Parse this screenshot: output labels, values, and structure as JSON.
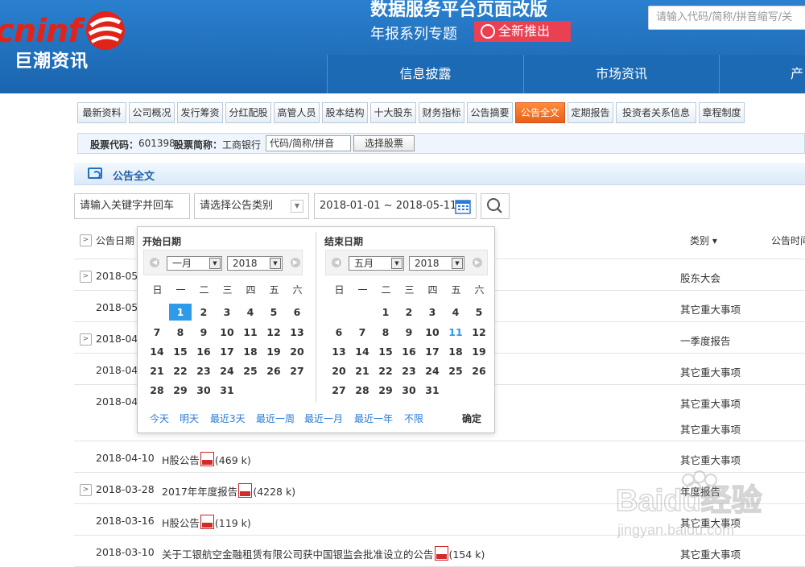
{
  "header": {
    "logo_text": "cninf",
    "logo_cn": "巨潮资讯",
    "promo_title": "数据服务平台页面改版",
    "promo_sub": "年报系列专题",
    "promo_badge": "全新推出",
    "search_placeholder": "请输入代码/简称/拼音缩写/关",
    "nav": [
      "信息披露",
      "市场资讯",
      "产品"
    ]
  },
  "tabs": [
    "最新资料",
    "公司概况",
    "发行筹资",
    "分红配股",
    "高管人员",
    "股本结构",
    "十大股东",
    "财务指标",
    "公告摘要",
    "公告全文",
    "定期报告",
    "投资者关系信息",
    "章程制度"
  ],
  "active_tab": "公告全文",
  "stock_bar": {
    "code_label": "股票代码：",
    "code": "601398",
    "name_label": "股票简称：",
    "name": "工商银行",
    "input_value": "代码/简称/拼音",
    "select_button": "选择股票"
  },
  "section_title": "公告全文",
  "filters": {
    "keyword_placeholder": "请输入关键字并回车",
    "category_placeholder": "请选择公告类别",
    "date_range": "2018-01-01 ~ 2018-05-11"
  },
  "table": {
    "col_date": "公告日期",
    "col_category": "类别",
    "col_time": "公告时间",
    "rows": [
      {
        "date": "2018-05",
        "title": "",
        "size": "",
        "category": "股东大会",
        "expand": true
      },
      {
        "date": "2018-05",
        "title": "",
        "size": "",
        "category": "其它重大事项",
        "expand": false
      },
      {
        "date": "2018-04",
        "title": "",
        "size": "",
        "category": "一季度报告",
        "expand": true
      },
      {
        "date": "2018-04",
        "title": "",
        "size": "",
        "category": "其它重大事项",
        "expand": false
      },
      {
        "date": "2018-04",
        "title": "",
        "size": "",
        "category": "其它重大事项",
        "category2": "其它重大事项",
        "expand": false
      },
      {
        "date": "2018-04-10",
        "title": "H股公告",
        "size": "(469 k)",
        "category": "其它重大事项",
        "expand": false
      },
      {
        "date": "2018-03-28",
        "title": "2017年年度报告",
        "size": "(4228 k)",
        "category": "年度报告",
        "expand": true
      },
      {
        "date": "2018-03-16",
        "title": "H股公告",
        "size": "(119 k)",
        "category": "其它重大事项",
        "expand": false
      },
      {
        "date": "2018-03-10",
        "title": "关于工银航空金融租赁有限公司获中国银监会批准设立的公告",
        "size": "(154 k)",
        "category": "其它重大事项",
        "expand": false
      }
    ]
  },
  "calendar": {
    "start_label": "开始日期",
    "end_label": "结束日期",
    "weekdays": [
      "日",
      "一",
      "二",
      "三",
      "四",
      "五",
      "六"
    ],
    "start": {
      "month": "一月",
      "year": "2018",
      "selected_day": 1,
      "weeks": [
        [
          "",
          "",
          "1",
          "2",
          "3",
          "4",
          "5",
          "6"
        ],
        [
          "7",
          "8",
          "9",
          "10",
          "11",
          "12",
          "13"
        ],
        [
          "14",
          "15",
          "16",
          "17",
          "18",
          "19",
          "20"
        ],
        [
          "21",
          "22",
          "23",
          "24",
          "25",
          "26",
          "27"
        ],
        [
          "28",
          "29",
          "30",
          "31",
          "",
          "",
          ""
        ]
      ]
    },
    "end": {
      "month": "五月",
      "year": "2018",
      "today_day": 11,
      "weeks": [
        [
          "",
          "",
          "1",
          "2",
          "3",
          "4",
          "5"
        ],
        [
          "6",
          "7",
          "8",
          "9",
          "10",
          "11",
          "12"
        ],
        [
          "13",
          "14",
          "15",
          "16",
          "17",
          "18",
          "19"
        ],
        [
          "20",
          "21",
          "22",
          "23",
          "24",
          "25",
          "26"
        ],
        [
          "27",
          "28",
          "29",
          "30",
          "31",
          "",
          ""
        ]
      ]
    },
    "quick_links": [
      "今天",
      "明天",
      "最近3天",
      "最近一周",
      "最近一月",
      "最近一年",
      "不限"
    ],
    "ok_label": "确定"
  },
  "watermark": {
    "brand": "Baidu经验",
    "url": "jingyan.baidu.com"
  },
  "colors": {
    "header_blue": "#1a69b5",
    "active_tab": "#e8601a",
    "link_blue": "#2a7bd6",
    "selected_day": "#2f9be8",
    "logo_red": "#e2231a"
  }
}
